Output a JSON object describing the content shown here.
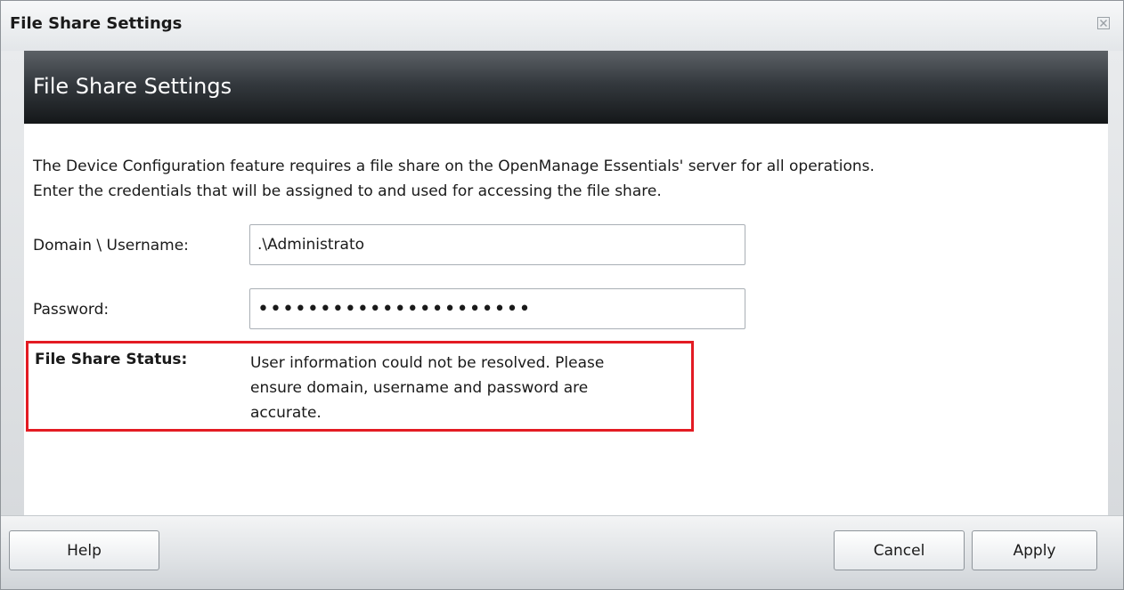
{
  "window": {
    "title": "File Share Settings"
  },
  "header": {
    "title": "File Share Settings"
  },
  "description": "The Device Configuration feature requires a file share on the OpenManage Essentials' server for all operations.\nEnter the credentials that will be assigned to and used for accessing the file share.",
  "form": {
    "username_label": "Domain \\ Username:",
    "username_value": ".\\Administrato",
    "password_label": "Password:",
    "password_value": "••••••••••••••••••••••"
  },
  "status": {
    "label": "File Share Status:",
    "text": "User information could not be resolved. Please\nensure domain, username and password are\naccurate.",
    "highlight_color": "#e31b23"
  },
  "footer": {
    "help_label": "Help",
    "cancel_label": "Cancel",
    "apply_label": "Apply"
  },
  "icons": {
    "close": "close-icon"
  }
}
